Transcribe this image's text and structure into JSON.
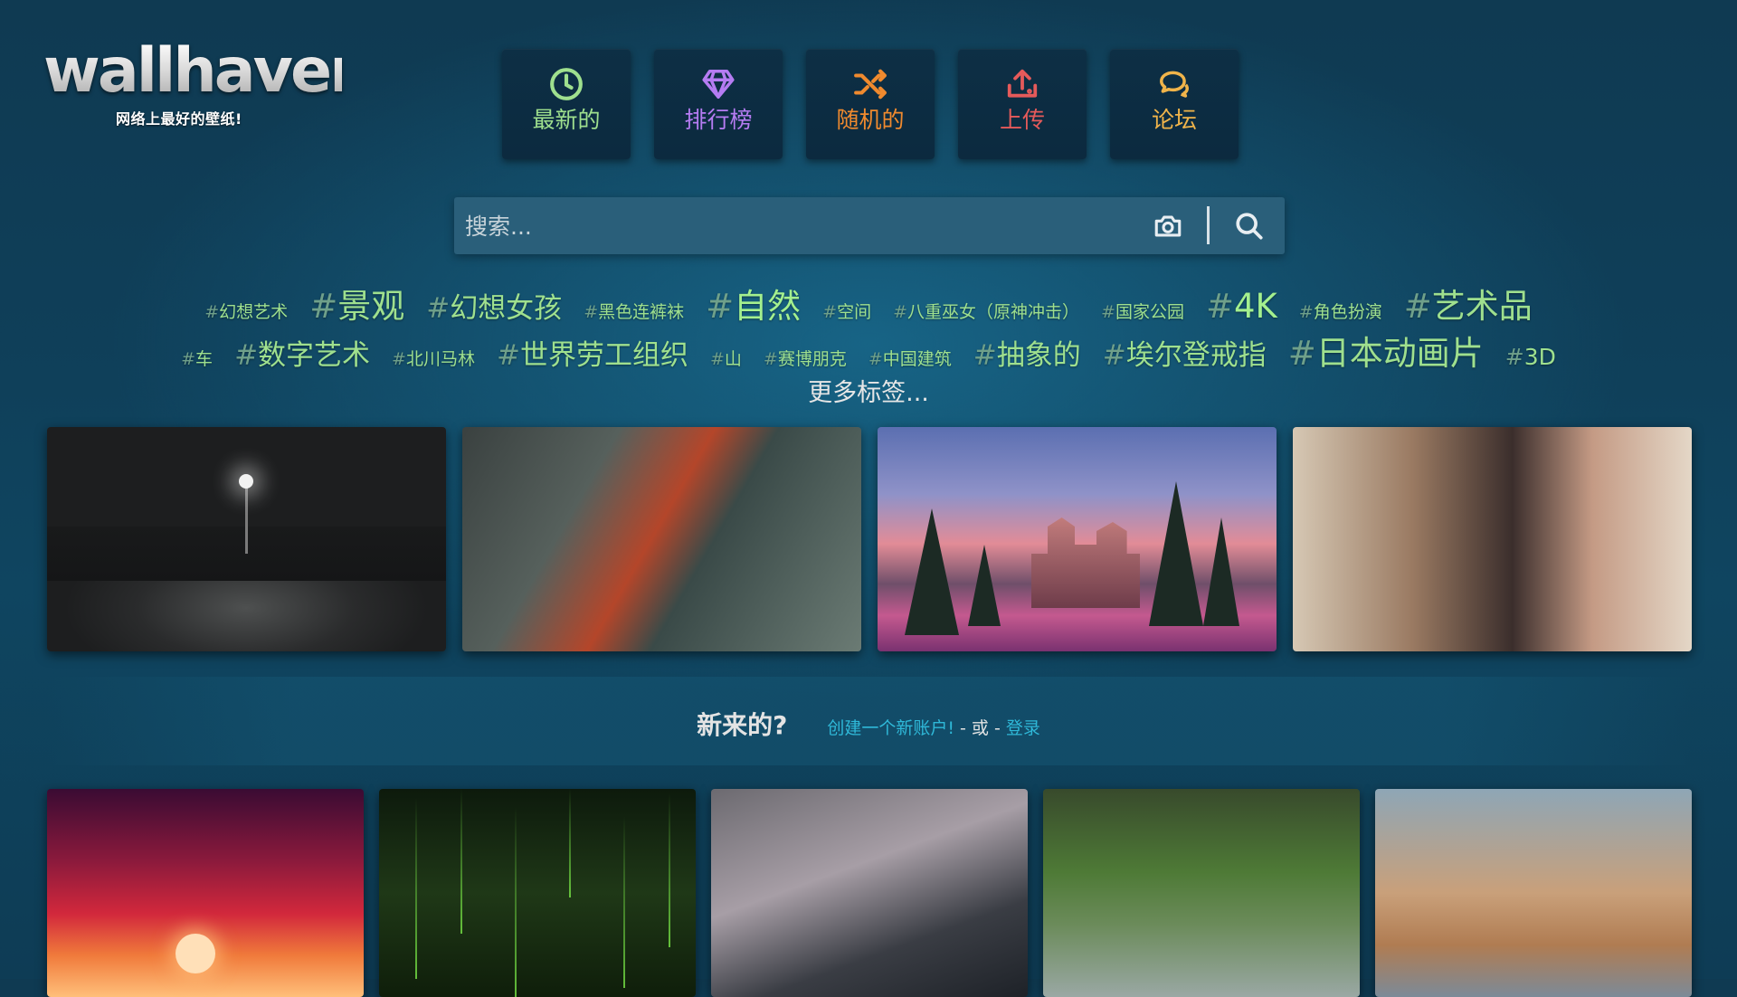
{
  "logo": {
    "word": "wallhaven",
    "tagline": "网络上最好的壁纸!"
  },
  "nav": [
    {
      "key": "latest",
      "label": "最新的",
      "icon": "clock-icon",
      "color": "#9fe08e"
    },
    {
      "key": "toplist",
      "label": "排行榜",
      "icon": "diamond-icon",
      "color": "#b57cf2"
    },
    {
      "key": "random",
      "label": "随机的",
      "icon": "shuffle-icon",
      "color": "#f08a2e"
    },
    {
      "key": "upload",
      "label": "上传",
      "icon": "upload-icon",
      "color": "#e55a5a"
    },
    {
      "key": "forums",
      "label": "论坛",
      "icon": "chat-icon",
      "color": "#f0b44a"
    }
  ],
  "search": {
    "placeholder": "搜索...",
    "value": ""
  },
  "tags_row1": [
    {
      "label": "幻想艺术",
      "size": 1
    },
    {
      "label": "景观",
      "size": 4
    },
    {
      "label": "幻想女孩",
      "size": 3
    },
    {
      "label": "黑色连裤袜",
      "size": 1
    },
    {
      "label": "自然",
      "size": 4
    },
    {
      "label": "空间",
      "size": 1
    },
    {
      "label": "八重巫女（原神冲击）",
      "size": 1
    },
    {
      "label": "国家公园",
      "size": 1
    },
    {
      "label": "4K",
      "size": 4
    },
    {
      "label": "角色扮演",
      "size": 1
    },
    {
      "label": "艺术品",
      "size": 4
    }
  ],
  "tags_row2": [
    {
      "label": "车",
      "size": 1
    },
    {
      "label": "数字艺术",
      "size": 3
    },
    {
      "label": "北川马林",
      "size": 1
    },
    {
      "label": "世界劳工组织",
      "size": 3
    },
    {
      "label": "山",
      "size": 1
    },
    {
      "label": "赛博朋克",
      "size": 1
    },
    {
      "label": "中国建筑",
      "size": 1
    },
    {
      "label": "抽象的",
      "size": 3
    },
    {
      "label": "埃尔登戒指",
      "size": 3
    },
    {
      "label": "日本动画片",
      "size": 4
    },
    {
      "label": "3D",
      "size": 2
    }
  ],
  "more_tags": "更多标签...",
  "signup": {
    "question": "新来的?",
    "create": "创建一个新账户!",
    "or": "- 或 -",
    "login": "登录"
  },
  "colors": {
    "tag": "#9fe08e",
    "link": "#2fb8d8",
    "search_bg": "#2a5f7a",
    "nav_bg": "#0d2f45"
  }
}
